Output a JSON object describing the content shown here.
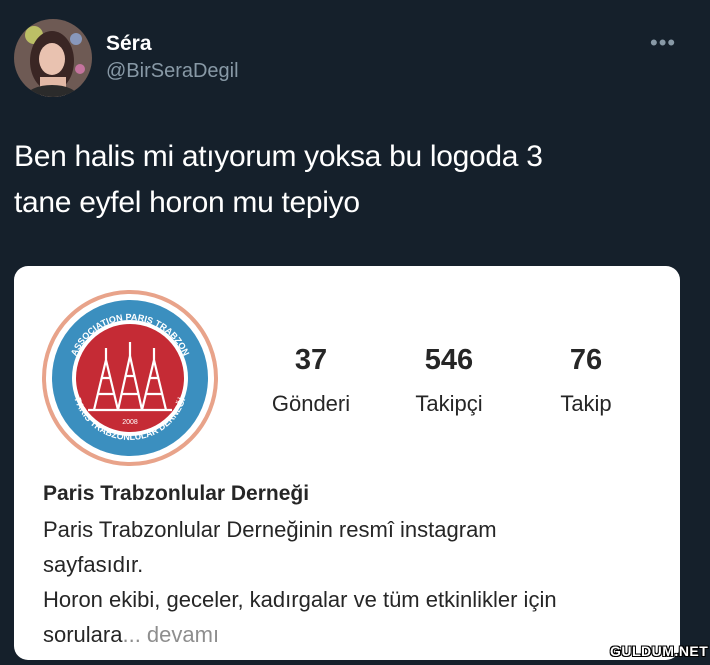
{
  "author": {
    "display_name": "Séra",
    "handle": "@BirSeraDegil"
  },
  "more_icon": "more-horizontal-icon",
  "tweet": {
    "text_line1": "Ben halis mi atıyorum yoksa bu logoda 3",
    "text_line2": "tane eyfel horon mu tepiyo"
  },
  "embed": {
    "logo": {
      "ring_text_top": "ASSOCIATION PARIS TRABZON",
      "ring_text_bottom": "PARIS TRABZONLULAR DERNEĞİ",
      "year": "2008",
      "colors": {
        "ring_outer": "#e8a38a",
        "ring_mid": "#3b8fbf",
        "center": "#c52b35"
      }
    },
    "stats": [
      {
        "value": "37",
        "label": "Gönderi"
      },
      {
        "value": "546",
        "label": "Takipçi"
      },
      {
        "value": "76",
        "label": "Takip"
      }
    ],
    "profile_name": "Paris Trabzonlular Derneği",
    "bio_lines": [
      "Paris Trabzonlular Derneğinin resmî instagram",
      "sayfasıdır.",
      "Horon ekibi, geceler, kadırgalar ve tüm etkinlikler için"
    ],
    "bio_last_text": "sorulara",
    "more_label": "... devamı"
  },
  "watermark": "GULDUM.NET",
  "colors": {
    "background": "#15202b",
    "secondary_text": "#8899a6"
  }
}
